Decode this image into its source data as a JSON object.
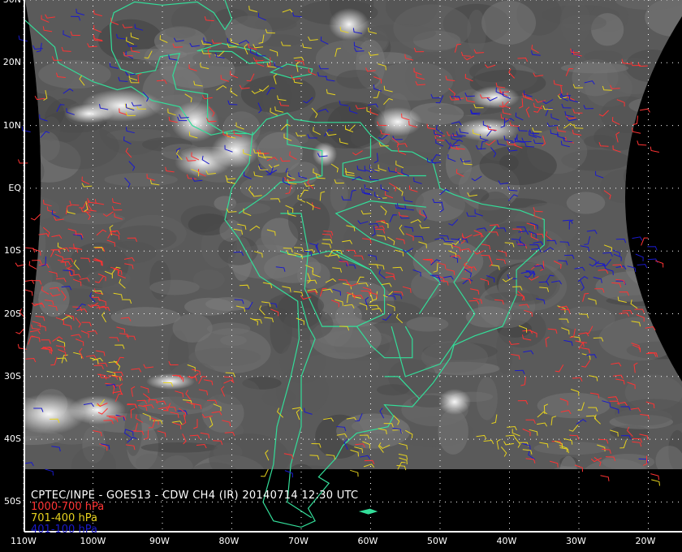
{
  "caption": "CPTEC/INPE - GOES13 - CDW CH4 (IR) 20140714 12:30 UTC",
  "legend": [
    {
      "label": "1000-700 hPa",
      "color": "#ff3333"
    },
    {
      "label": "701-400 hPa",
      "color": "#e6d21e"
    },
    {
      "label": "401-100 hPa",
      "color": "#1a1acc"
    }
  ],
  "lat_labels": [
    "30N",
    "20N",
    "10N",
    "EQ",
    "10S",
    "20S",
    "30S",
    "40S",
    "50S"
  ],
  "lon_labels": [
    "110W",
    "100W",
    "90W",
    "80W",
    "70W",
    "60W",
    "50W",
    "40W",
    "30W",
    "20W"
  ],
  "colors": {
    "coast": "#33dd99",
    "frame": "#ffffff",
    "grid": "#ffffff"
  }
}
